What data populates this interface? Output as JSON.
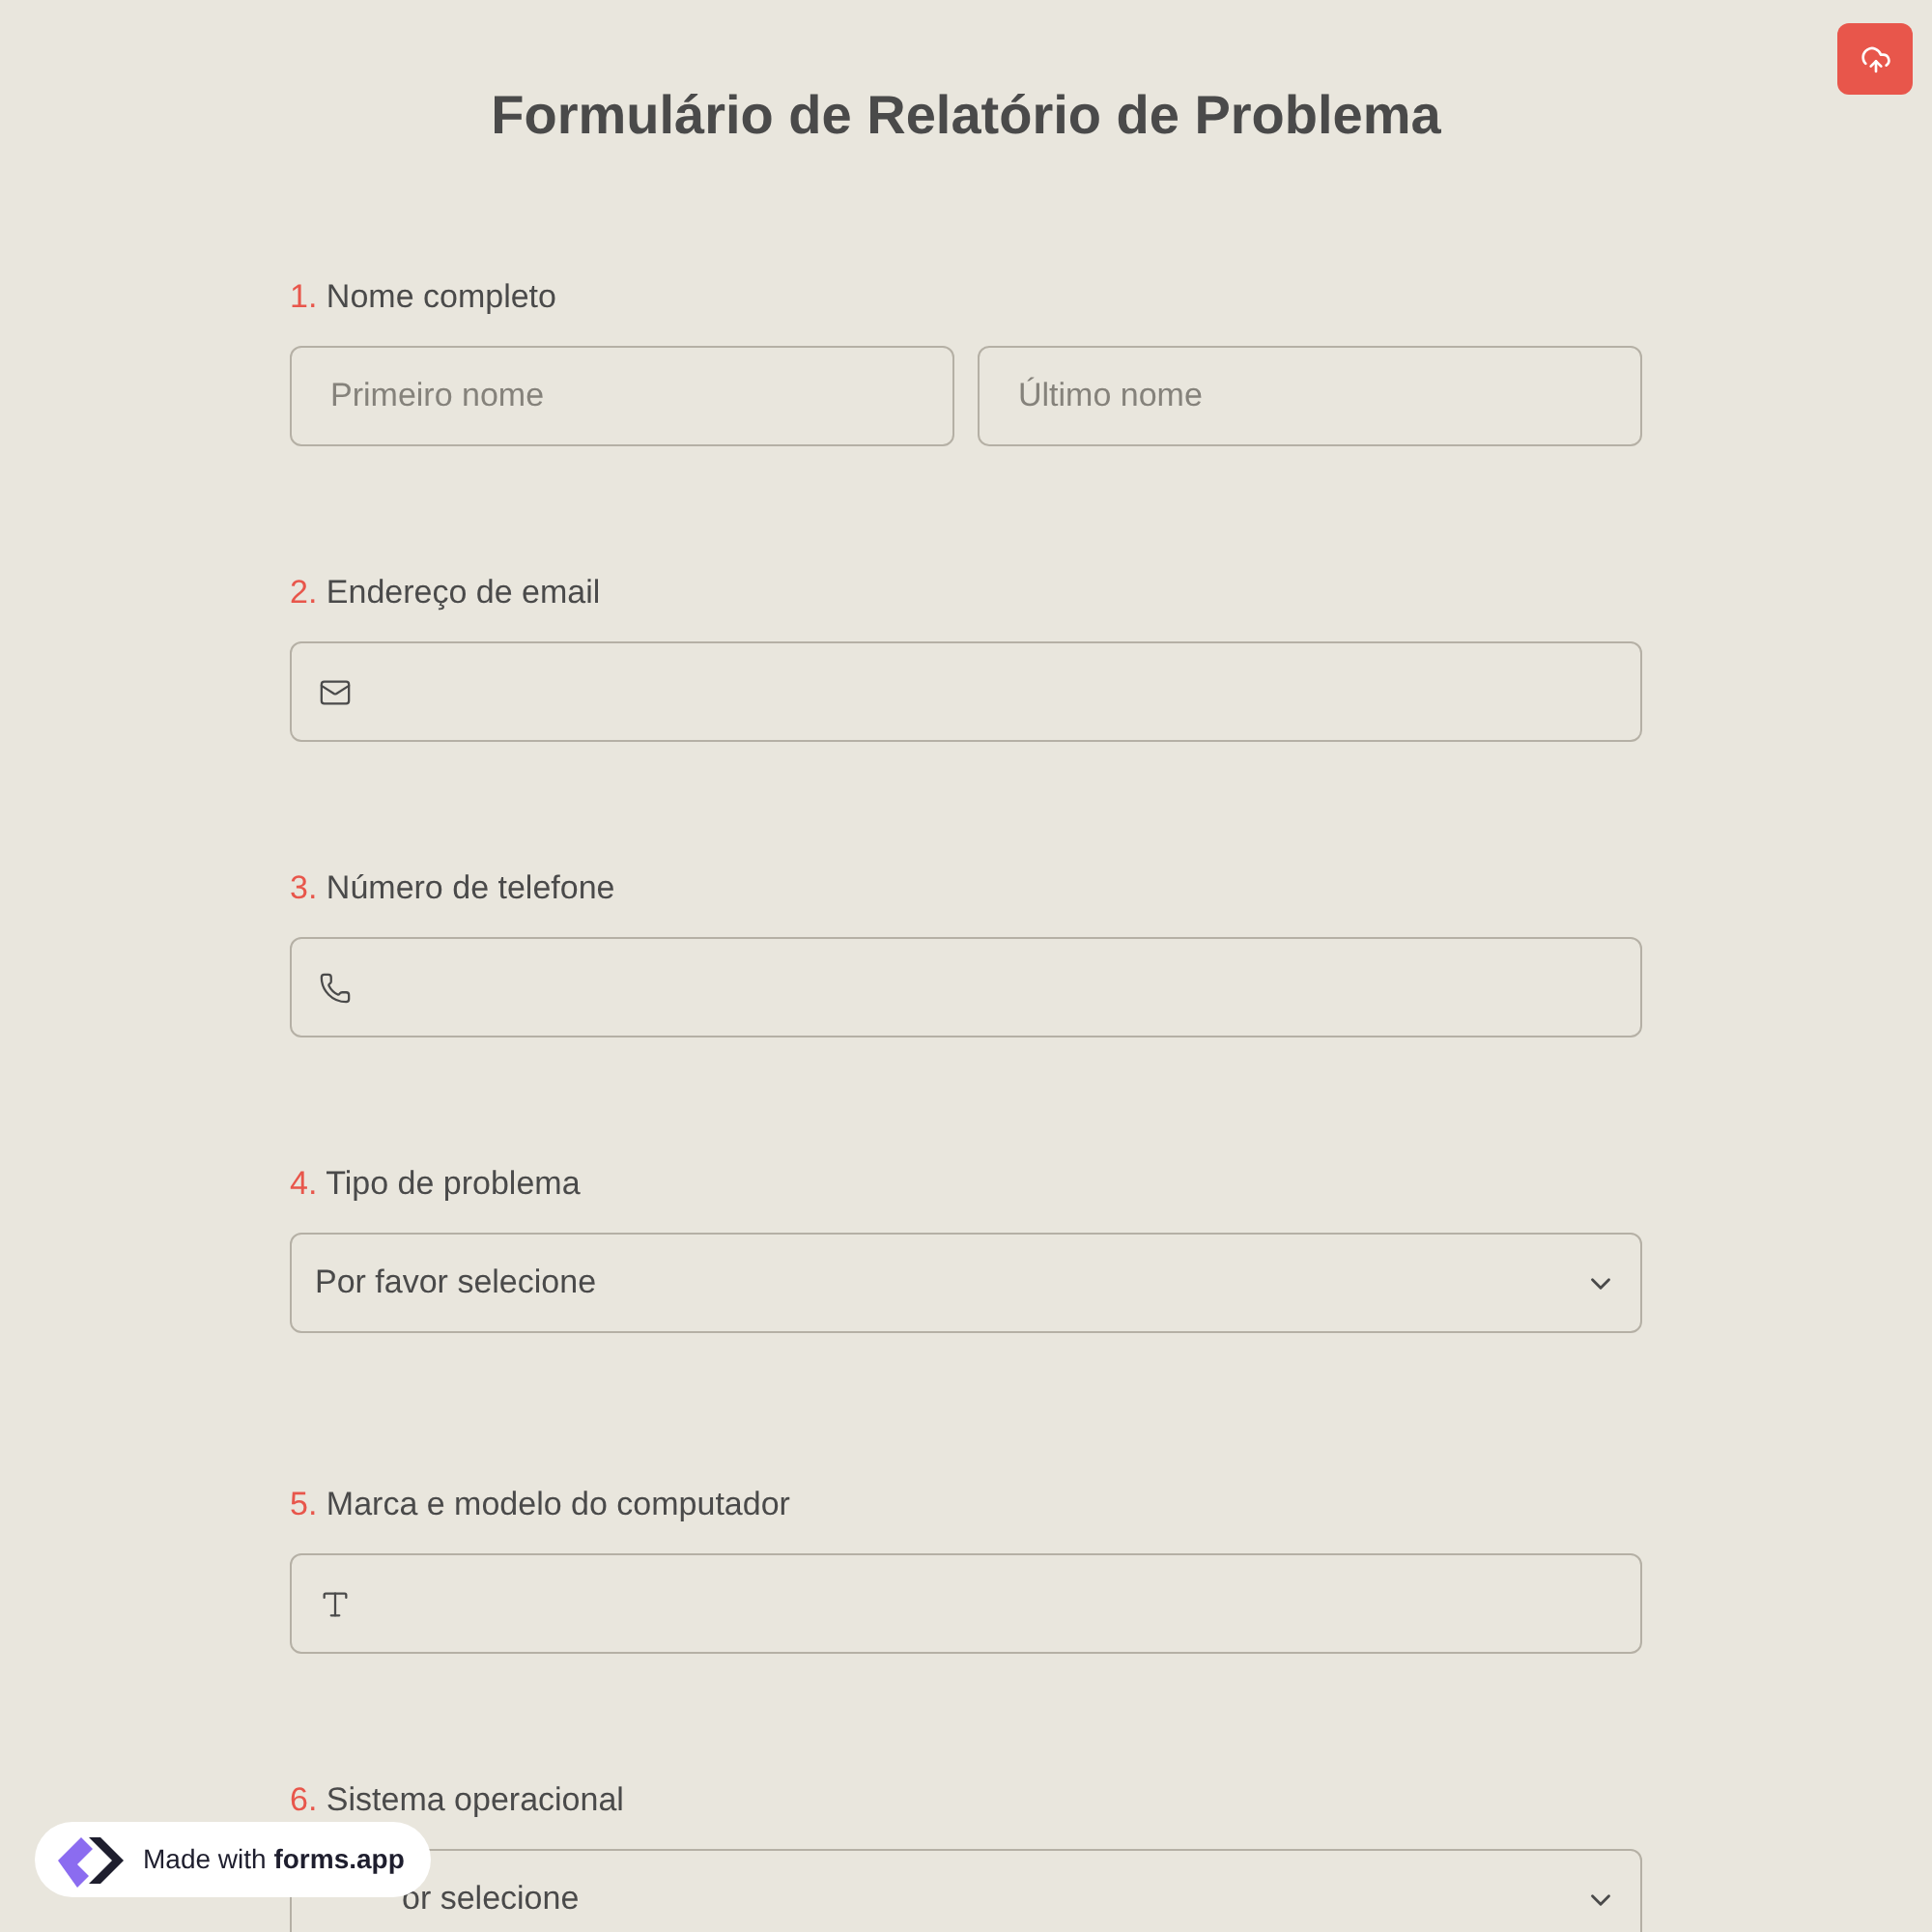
{
  "title": "Formulário de Relatório de Problema",
  "questions": [
    {
      "number": "1.",
      "label": "Nome completo",
      "kind": "name",
      "placeholders": [
        "Primeiro nome",
        "Último nome"
      ]
    },
    {
      "number": "2.",
      "label": "Endereço de email",
      "kind": "email"
    },
    {
      "number": "3.",
      "label": "Número de telefone",
      "kind": "phone"
    },
    {
      "number": "4.",
      "label": "Tipo de problema",
      "kind": "select",
      "placeholder": "Por favor selecione"
    },
    {
      "number": "5.",
      "label": "Marca e modelo do computador",
      "kind": "text"
    },
    {
      "number": "6.",
      "label": "Sistema operacional",
      "kind": "select",
      "placeholder": "or selecione",
      "partly_hidden": true
    }
  ],
  "badge": {
    "prefix": "Made with",
    "brand": "forms.app"
  }
}
